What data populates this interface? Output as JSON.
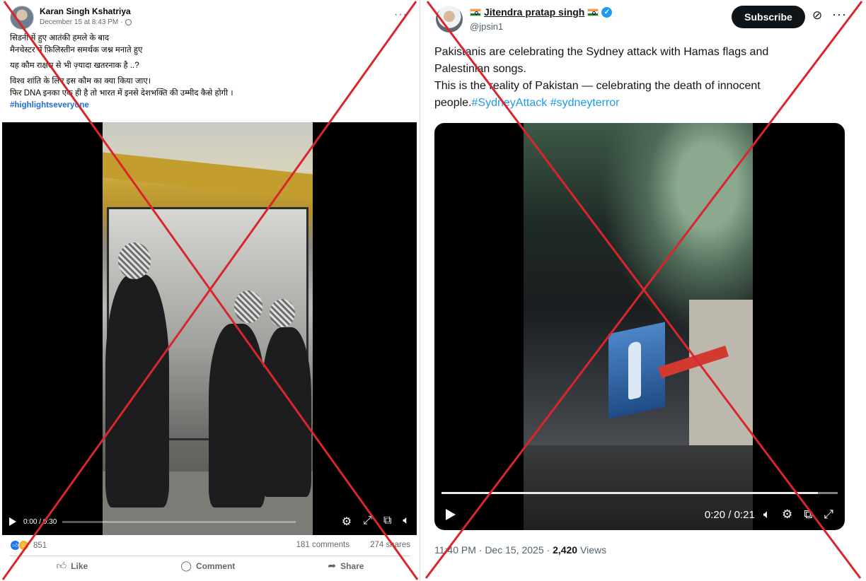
{
  "facebook_post": {
    "author_name": "Karan Singh Kshatriya",
    "timestamp": "December 15 at 8:43 PM",
    "more_glyph": "···",
    "text_lines": [
      "सिडनी में हुए आतंकी हमले के बाद",
      "मैनचेस्टर में फ़िलिस्तीन समर्थक जश्न मनाते हुए",
      "यह कौम राक्षस से भी ज़्यादा खतरनाक है ..?",
      "विश्व शांति के लिए इस कौम का क्या किया जाए।",
      "फिर DNA इनका एक ही है तो भारत में इनसे देशभक्ति की उम्मीद कैसे होगी ।"
    ],
    "hashtag": "#highlightseveryone",
    "video": {
      "time": "0:00 / 0:30",
      "progress_fraction": 0.0
    },
    "reaction_count": "851",
    "comments": "181 comments",
    "shares": "274 shares",
    "actions": {
      "like": "Like",
      "comment": "Comment",
      "share": "Share"
    }
  },
  "x_post": {
    "author_name": "Jitendra pratap singh",
    "handle": "@jpsin1",
    "subscribe_label": "Subscribe",
    "more_glyph": "···",
    "text_lines": [
      "Pakistanis are celebrating the Sydney attack with Hamas flags and",
      "Palestinian songs.",
      "This is the reality of Pakistan — celebrating the death of innocent"
    ],
    "last_line_prefix": "people.",
    "hashtags": [
      "#SydneyAttack",
      "#sydneyterror"
    ],
    "video": {
      "time": "0:20 / 0:21",
      "progress_fraction": 0.95
    },
    "post_time": "11:40 PM · Dec 15, 2025 · ",
    "views_count": "2,420",
    "views_label": " Views"
  },
  "colors": {
    "cross_red": "#d9252b",
    "fb_blue": "#216fdb",
    "x_blue": "#1d9bf0"
  }
}
